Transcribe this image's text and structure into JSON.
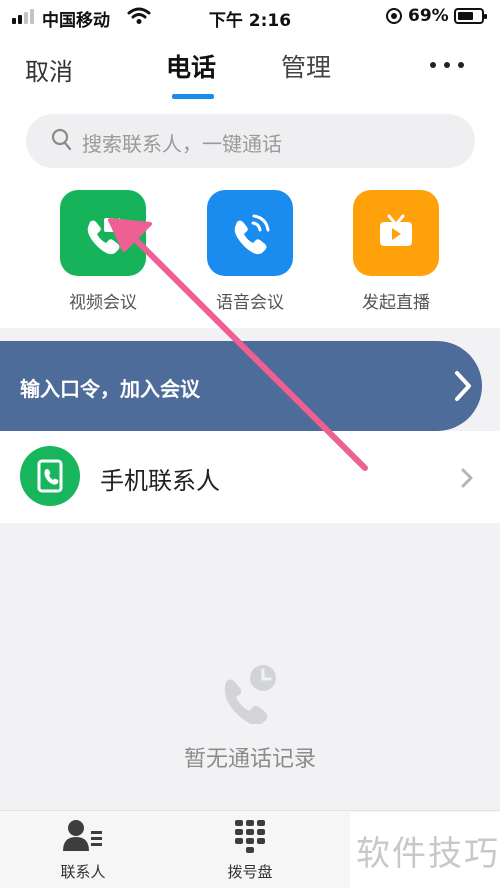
{
  "status_bar": {
    "carrier": "中国移动",
    "time": "下午 2:16",
    "battery_percent_label": "69%",
    "battery_level": 0.69
  },
  "nav": {
    "cancel": "取消",
    "tab_phone": "电话",
    "tab_manage": "管理"
  },
  "search": {
    "placeholder": "搜索联系人，一键通话"
  },
  "actions": [
    {
      "label": "视频会议",
      "icon": "video-call-icon",
      "color": "#17b35a"
    },
    {
      "label": "语音会议",
      "icon": "voice-call-icon",
      "color": "#1a8cf0"
    },
    {
      "label": "发起直播",
      "icon": "live-tv-icon",
      "color": "#ffa10a"
    }
  ],
  "join_meeting": {
    "label": "输入口令，加入会议",
    "color": "#4d6c99"
  },
  "phone_contacts": {
    "label": "手机联系人",
    "color": "#18b65c"
  },
  "empty_state": {
    "text": "暂无通话记录"
  },
  "tabbar": {
    "contacts": "联系人",
    "dialpad": "拨号盘"
  },
  "watermark": "软件技巧",
  "annotation": {
    "color": "#ee5f94"
  }
}
